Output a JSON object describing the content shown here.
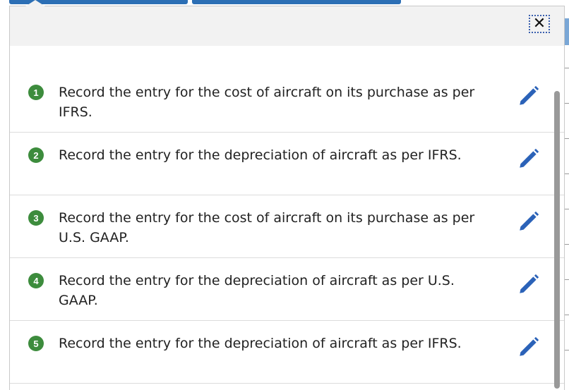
{
  "close_icon_glyph": "✕",
  "items": [
    {
      "number": "1",
      "text": "Record the entry for the cost of aircraft on its purchase as per IFRS.",
      "icon": "pencil-icon"
    },
    {
      "number": "2",
      "text": "Record the entry for the depreciation of aircraft as per IFRS.",
      "icon": "pencil-icon"
    },
    {
      "number": "3",
      "text": "Record the entry for the cost of aircraft on its purchase as per U.S. GAAP.",
      "icon": "pencil-icon"
    },
    {
      "number": "4",
      "text": "Record the entry for the depreciation of aircraft as per U.S. GAAP.",
      "icon": "pencil-icon"
    },
    {
      "number": "5",
      "text": "Record the entry for the depreciation of aircraft as per IFRS.",
      "icon": "pencil-icon"
    }
  ],
  "colors": {
    "badge": "#3d8c3d",
    "pencil": "#2b62b8",
    "tab": "#2c6fb5",
    "header_bg": "#f2f2f2"
  }
}
